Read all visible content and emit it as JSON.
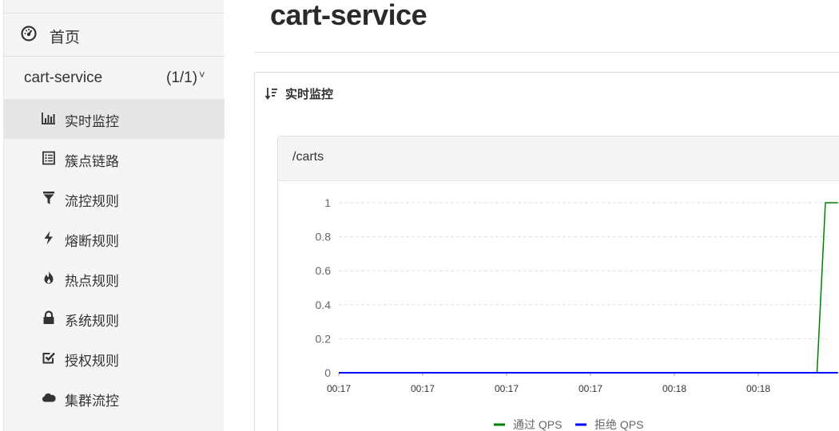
{
  "sidebar": {
    "home": {
      "label": "首页",
      "icon": "dashboard-icon"
    },
    "app": {
      "name": "cart-service",
      "count": "(1/1)",
      "chevron": "˅"
    },
    "items": [
      {
        "label": "实时监控",
        "icon": "bar-chart-icon",
        "active": true
      },
      {
        "label": "簇点链路",
        "icon": "list-icon",
        "active": false
      },
      {
        "label": "流控规则",
        "icon": "filter-icon",
        "active": false
      },
      {
        "label": "熔断规则",
        "icon": "lightning-icon",
        "active": false
      },
      {
        "label": "热点规则",
        "icon": "fire-icon",
        "active": false
      },
      {
        "label": "系统规则",
        "icon": "lock-icon",
        "active": false
      },
      {
        "label": "授权规则",
        "icon": "check-square-icon",
        "active": false
      },
      {
        "label": "集群流控",
        "icon": "cloud-icon",
        "active": false
      }
    ]
  },
  "main": {
    "title": "cart-service",
    "section": {
      "title": "实时监控",
      "icon": "sort-icon"
    },
    "card": {
      "resource": "/carts"
    }
  },
  "chart_data": {
    "type": "line",
    "x": [
      "00:17",
      "00:17",
      "00:17",
      "00:17",
      "00:18",
      "00:18"
    ],
    "ylim": [
      0,
      1
    ],
    "yticks": [
      "0",
      "0.2",
      "0.4",
      "0.6",
      "0.8",
      "1"
    ],
    "grid": true,
    "legend_position": "bottom",
    "series": [
      {
        "name": "通过 QPS",
        "color": "#008000",
        "x": [
          0,
          1,
          2,
          3,
          4,
          5,
          5.7,
          5.8,
          5.95
        ],
        "values": [
          0,
          0,
          0,
          0,
          0,
          0,
          0,
          1,
          1
        ]
      },
      {
        "name": "拒绝 QPS",
        "color": "#0000ff",
        "x": [
          0,
          1,
          2,
          3,
          4,
          5,
          5.95
        ],
        "values": [
          0,
          0,
          0,
          0,
          0,
          0,
          0
        ]
      }
    ]
  }
}
